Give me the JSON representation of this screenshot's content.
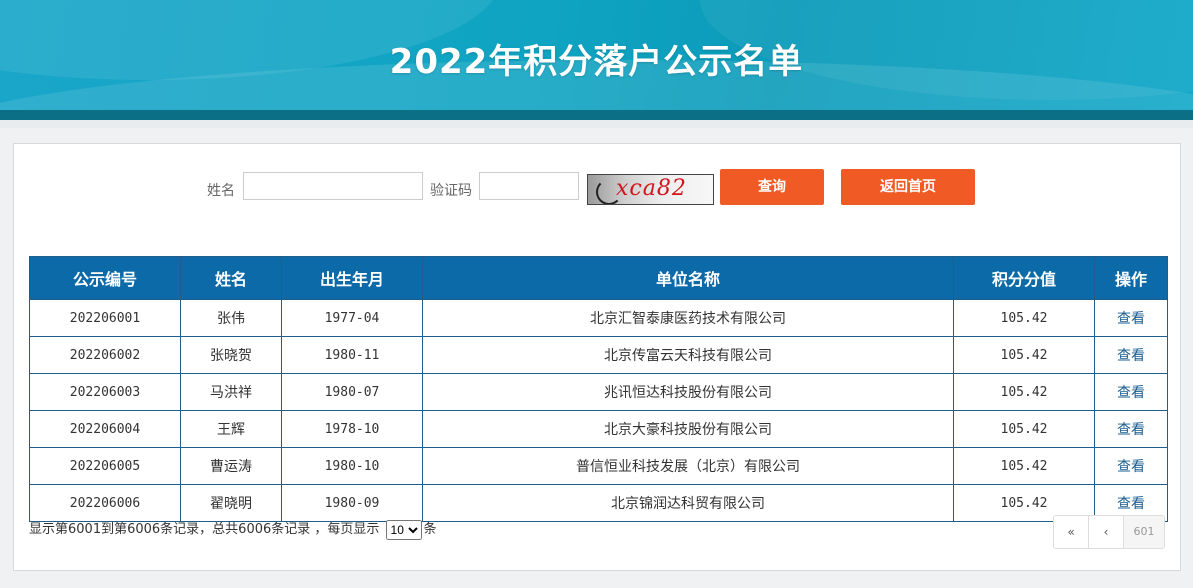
{
  "header": {
    "title": "2022年积分落户公示名单"
  },
  "search": {
    "name_label": "姓名",
    "name_value": "",
    "captcha_label": "验证码",
    "captcha_value": "",
    "captcha_image_text": "xca82",
    "query_button": "查询",
    "home_button": "返回首页"
  },
  "table": {
    "columns": [
      "公示编号",
      "姓名",
      "出生年月",
      "单位名称",
      "积分分值",
      "操作"
    ],
    "rows": [
      [
        "202206001",
        "张伟",
        "1977-04",
        "北京汇智泰康医药技术有限公司",
        "105.42",
        "查看"
      ],
      [
        "202206002",
        "张晓贺",
        "1980-11",
        "北京传富云天科技有限公司",
        "105.42",
        "查看"
      ],
      [
        "202206003",
        "马洪祥",
        "1980-07",
        "兆讯恒达科技股份有限公司",
        "105.42",
        "查看"
      ],
      [
        "202206004",
        "王辉",
        "1978-10",
        "北京大豪科技股份有限公司",
        "105.42",
        "查看"
      ],
      [
        "202206005",
        "曹运涛",
        "1980-10",
        "普信恒业科技发展（北京）有限公司",
        "105.42",
        "查看"
      ],
      [
        "202206006",
        "翟晓明",
        "1980-09",
        "北京锦润达科贸有限公司",
        "105.42",
        "查看"
      ]
    ]
  },
  "footer": {
    "summary": "显示第6001到第6006条记录，总共6006条记录 ，每页显示",
    "page_size": "10",
    "suffix": "条"
  },
  "pager": {
    "first": "«",
    "prev": "‹",
    "current": "601"
  },
  "colors": {
    "header_bg": "#0d6aa8",
    "button_bg": "#f05a24",
    "banner": "#1aa6c9"
  }
}
